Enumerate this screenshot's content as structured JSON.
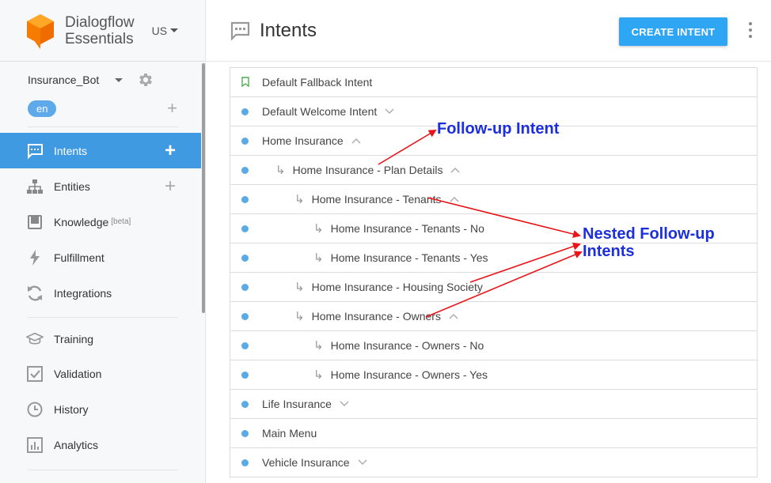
{
  "brand": {
    "line1": "Dialogflow",
    "line2": "Essentials",
    "region": "US"
  },
  "agent": {
    "name": "Insurance_Bot",
    "language": "en"
  },
  "nav": {
    "intents": "Intents",
    "entities": "Entities",
    "knowledge": "Knowledge",
    "knowledge_badge": "[beta]",
    "fulfillment": "Fulfillment",
    "integrations": "Integrations",
    "training": "Training",
    "validation": "Validation",
    "history": "History",
    "analytics": "Analytics"
  },
  "header": {
    "title": "Intents",
    "create_button": "CREATE INTENT"
  },
  "intents": [
    {
      "name": "Default Fallback Intent",
      "level": 0,
      "marker": "bookmark",
      "chevron": "none"
    },
    {
      "name": "Default Welcome Intent",
      "level": 0,
      "marker": "dot",
      "chevron": "down"
    },
    {
      "name": "Home Insurance",
      "level": 0,
      "marker": "dot",
      "chevron": "up"
    },
    {
      "name": "Home Insurance - Plan Details",
      "level": 1,
      "marker": "dot",
      "chevron": "up"
    },
    {
      "name": "Home Insurance - Tenants",
      "level": 2,
      "marker": "dot",
      "chevron": "up"
    },
    {
      "name": "Home Insurance - Tenants - No",
      "level": 3,
      "marker": "dot",
      "chevron": "none"
    },
    {
      "name": "Home Insurance - Tenants - Yes",
      "level": 3,
      "marker": "dot",
      "chevron": "none"
    },
    {
      "name": "Home Insurance - Housing Society",
      "level": 2,
      "marker": "dot",
      "chevron": "none"
    },
    {
      "name": "Home Insurance - Owners",
      "level": 2,
      "marker": "dot",
      "chevron": "up"
    },
    {
      "name": "Home Insurance - Owners - No",
      "level": 3,
      "marker": "dot",
      "chevron": "none"
    },
    {
      "name": "Home Insurance - Owners - Yes",
      "level": 3,
      "marker": "dot",
      "chevron": "none"
    },
    {
      "name": "Life Insurance",
      "level": 0,
      "marker": "dot",
      "chevron": "down"
    },
    {
      "name": "Main Menu",
      "level": 0,
      "marker": "dot",
      "chevron": "none"
    },
    {
      "name": "Vehicle Insurance",
      "level": 0,
      "marker": "dot",
      "chevron": "down"
    }
  ],
  "annotations": {
    "follow_up": "Follow-up Intent",
    "nested_line1": "Nested Follow-up",
    "nested_line2": "Intents"
  },
  "colors": {
    "accent": "#3f9ae2",
    "button": "#2ea6f4",
    "dot": "#5aaae6",
    "annotation_text": "#1c2fdc",
    "annotation_arrow": "#e8161b"
  },
  "icons": {
    "logo": "dialogflow-logo",
    "settings": "gear-icon",
    "intents": "chat-bubble-icon",
    "entities": "hierarchy-icon",
    "knowledge": "book-icon",
    "fulfillment": "bolt-icon",
    "integrations": "sync-icon",
    "training": "graduation-cap-icon",
    "validation": "checkbox-icon",
    "history": "clock-icon",
    "analytics": "bar-chart-icon"
  }
}
